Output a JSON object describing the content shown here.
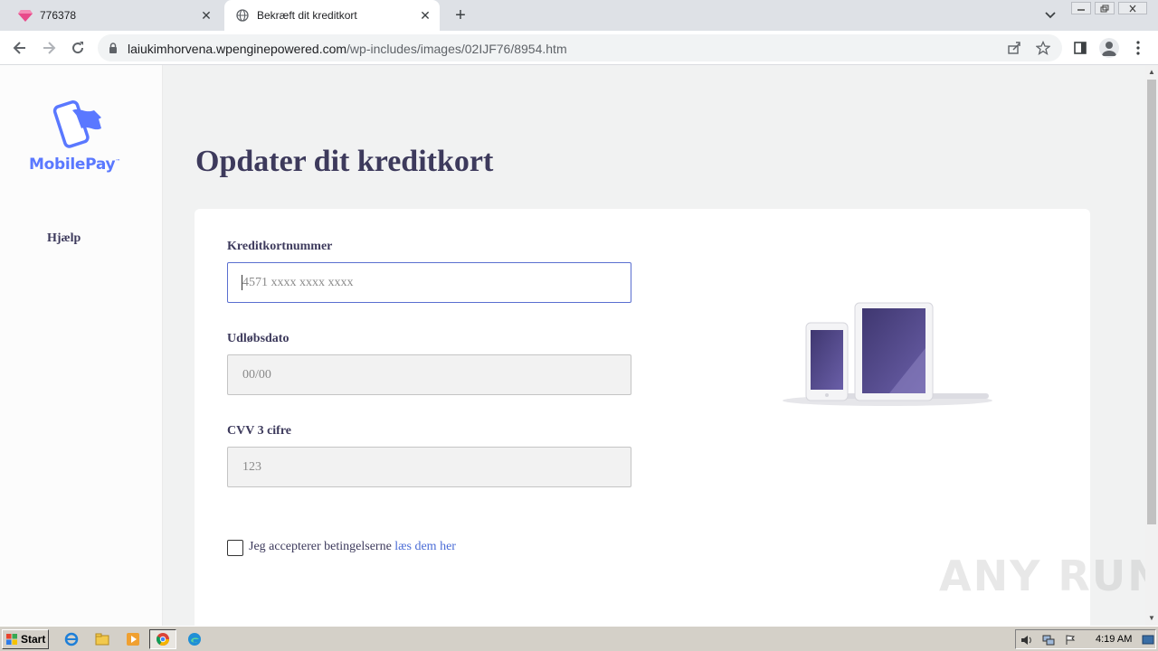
{
  "browser": {
    "tabs": [
      {
        "title": "776378",
        "active": false
      },
      {
        "title": "Bekræft dit kreditkort",
        "active": true
      }
    ],
    "new_tab_label": "+",
    "close_label": "✕",
    "url_domain": "laiukimhorvena.wpenginepowered.com",
    "url_path": "/wp-includes/images/02IJF76/8954.htm"
  },
  "sidebar": {
    "logo_text": "MobilePay",
    "logo_tm": "™",
    "help_label": "Hjælp"
  },
  "page": {
    "heading": "Opdater dit kreditkort",
    "card_number_label": "Kreditkortnummer",
    "card_number_placeholder": "4571 xxxx xxxx xxxx",
    "expiry_label": "Udløbsdato",
    "expiry_placeholder": "00/00",
    "cvv_label": "CVV 3 cifre",
    "cvv_placeholder": "123",
    "consent_text": "Jeg accepterer betingelserne ",
    "consent_link": "læs dem her",
    "consent_checked": false
  },
  "watermark": "ANY RUN",
  "taskbar": {
    "start_label": "Start",
    "clock": "4:19 AM"
  },
  "colors": {
    "brand": "#5a78ff",
    "heading": "#3d3a5c",
    "link": "#4a6cd6",
    "page_bg": "#f1f2f2"
  }
}
